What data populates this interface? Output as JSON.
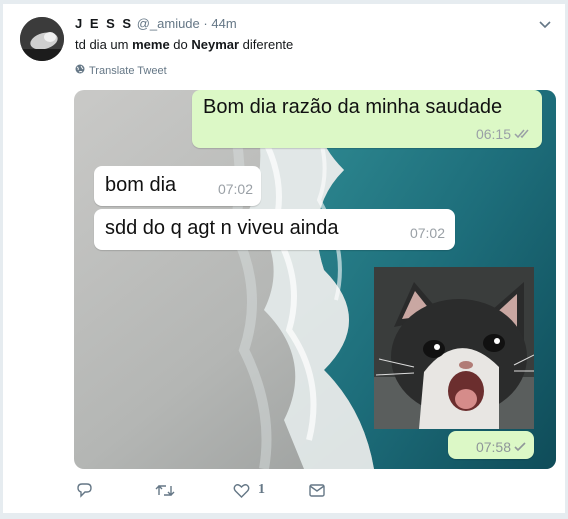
{
  "tweet": {
    "display_name": "J E S S",
    "handle": "@_amiude",
    "separator": "·",
    "time_ago": "44m",
    "text_parts": [
      "td dia um ",
      "meme",
      " do ",
      "Neymar",
      " diferente"
    ],
    "translate_label": "Translate Tweet"
  },
  "chat": {
    "messages": [
      {
        "text": "Bom dia razão da minha saudade",
        "time": "06:15",
        "direction": "outgoing",
        "status": "read"
      },
      {
        "text": "bom dia",
        "time": "07:02",
        "direction": "incoming"
      },
      {
        "text": "sdd do q agt n viveu ainda",
        "time": "07:02",
        "direction": "incoming"
      },
      {
        "text": "",
        "time": "07:58",
        "direction": "outgoing",
        "status": "sent",
        "attachment": "crying-cat-image"
      }
    ]
  },
  "actions": {
    "reply_icon": "reply-icon",
    "retweet_icon": "retweet-icon",
    "like_icon": "heart-icon",
    "like_count": "1",
    "message_icon": "envelope-icon"
  },
  "colors": {
    "outgoing_bubble": "#dcf8c6",
    "incoming_bubble": "#ffffff",
    "muted_text": "#657786",
    "check_color": "#9aa0a6"
  }
}
